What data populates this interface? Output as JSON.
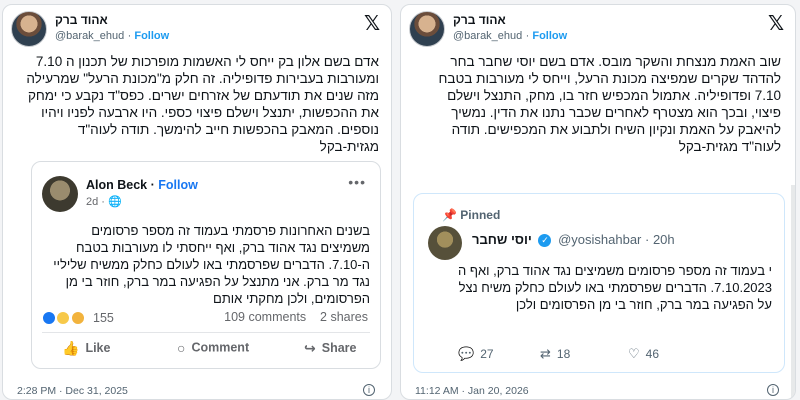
{
  "left_card": {
    "author_name": "אהוד ברק",
    "handle": "@barak_ehud",
    "follow_label": "Follow",
    "text": "אדם בשם אלון בק ייחס לי האשמות מופרכות של תכנון ה 7.10 ומעורבות בעבירות פדופיליה. זה חלק מ\"מכונת הרעל\" שמרעילה מזה שנים את תודעתם של אזרחים ישרים. כפס\"ד נקבע כי ימחק את ההכפשות, יתנצל וישלם פיצוי כספי. היו ארבעה לפניו ויהיו נוספים. המאבק בהכפשות חייב להימשך. תודה לעוה\"ד מגזית-בקל",
    "embed": {
      "author": "Alon Beck",
      "follow_label": "Follow",
      "meta": "2d · 🌐",
      "more": "•••",
      "text": "בשנים האחרונות פרסמתי בעמוד זה מספר פרסומים משמיצים נגד אהוד ברק, ואף ייחסתי לו מעורבות בטבח ה-7.10. הדברים שפרסמתי באו לעולם כחלק ממשיח שליליי נגד מר ברק. אני מתנצל על הפגיעה במר ברק, חוזר בי מן הפרסומים, ולכן מחקתי אותם",
      "reactions_count": "155",
      "comments": "109 comments",
      "shares": "2 shares",
      "actions": [
        "Like",
        "Comment",
        "Share"
      ]
    },
    "timestamp": "2:28 PM · Dec 31, 2025"
  },
  "right_card": {
    "author_name": "אהוד ברק",
    "handle": "@barak_ehud",
    "follow_label": "Follow",
    "text": "שוב האמת מנצחת והשקר מובס. אדם בשם יוסי שחבר בחר להדהד שקרים שמפיצה מכונת הרעל, וייחס לי מעורבות בטבח 7.10 ופדופיליה. אתמול המכפיש חזר בו, מחק, התנצל וישלם פיצוי, ובכך הוא מצטרף לאחרים שכבר נתנו את הדין. נמשיך להיאבק על האמת ונקיון השיח ולתבוע את המכפישים. תודה לעוה\"ד מגזית-בקל",
    "embed": {
      "pinned_label": "Pinned",
      "author": "יוסי שחבר",
      "handle": "@yosishahbar · 20h",
      "text": "י בעמוד זה מספר פרסומים משמיצים נגד אהוד ברק, ואף ה 7.10.2023. הדברים שפרסמתי באו לעולם כחלק משיח נצל על הפגיעה במר ברק, חוזר בי מן הפרסומים ולכן",
      "replies": "27",
      "reposts": "18",
      "likes": "46"
    },
    "timestamp": "11:12 AM · Jan 20, 2026"
  },
  "colors": {
    "x_blue": "#1d9bf0",
    "fb_blue": "#1877f2"
  },
  "icons": {
    "x_logo": "𝕏",
    "info": "i",
    "like": "👍",
    "comment": "○",
    "share": "↪",
    "pin": "📌",
    "reply": "💬",
    "repost": "⇄",
    "heart": "♡",
    "verified": "✓"
  }
}
